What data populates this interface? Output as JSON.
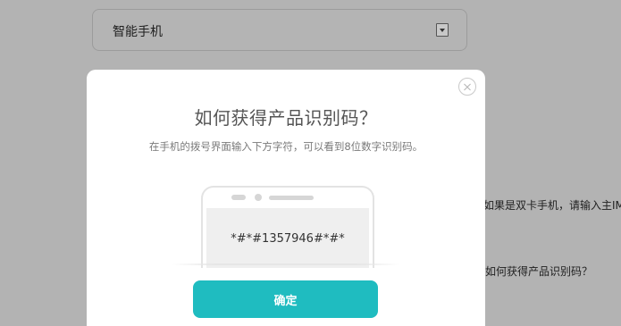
{
  "background": {
    "select_value": "智能手机",
    "hint_dual_sim": "如果是双卡手机，请输入主IM",
    "hint_how_to": "如何获得产品识别码？"
  },
  "modal": {
    "title": "如何获得产品识别码？",
    "description": "在手机的拨号界面输入下方字符，可以看到8位数字识别码。",
    "phone_code": "*#*#1357946#*#*",
    "confirm_label": "确定"
  },
  "icons": {
    "close": "close-icon",
    "select_arrow": "chevron-down-icon"
  },
  "colors": {
    "overlay": "#b3b3b3",
    "confirm_button": "#1fbcc0",
    "modal_background": "#ffffff"
  }
}
